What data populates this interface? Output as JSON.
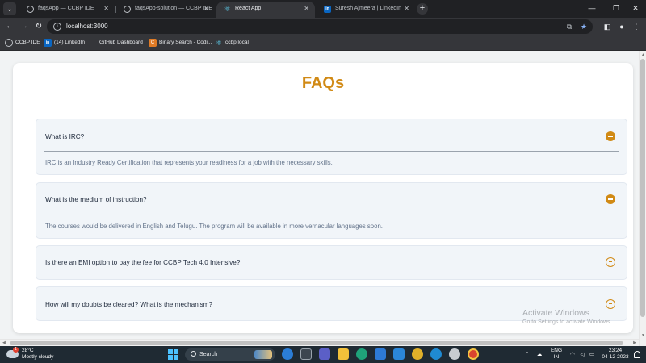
{
  "browser": {
    "tabs": [
      {
        "title": "faqsApp — CCBP IDE",
        "active": false,
        "icon": "ccbp-ide-icon"
      },
      {
        "title": "faqsApp-solution — CCBP IDE",
        "active": false,
        "icon": "ccbp-ide-icon"
      },
      {
        "title": "React App",
        "active": true,
        "icon": "react-icon"
      },
      {
        "title": "Suresh Ajmeera | LinkedIn",
        "active": false,
        "icon": "linkedin-icon"
      }
    ],
    "url": "localhost:3000",
    "bookmarks": [
      {
        "label": "CCBP IDE",
        "icon": "ccbp-ide-icon"
      },
      {
        "label": "(14) LinkedIn",
        "icon": "linkedin-icon"
      },
      {
        "label": "GitHub Dashboard",
        "icon": "github-icon"
      },
      {
        "label": "Binary Search - Codi...",
        "icon": "code-icon"
      },
      {
        "label": "ccbp local",
        "icon": "react-icon"
      }
    ]
  },
  "page": {
    "title": "FAQs",
    "accent": "#d18a15",
    "faqs": [
      {
        "question": "What is IRC?",
        "answer": "IRC is an Industry Ready Certification that represents your readiness for a job with the necessary skills.",
        "expanded": true
      },
      {
        "question": "What is the medium of instruction?",
        "answer": "The courses would be delivered in English and Telugu. The program will be available in more vernacular languages soon.",
        "expanded": true
      },
      {
        "question": "Is there an EMI option to pay the fee for CCBP Tech 4.0 Intensive?",
        "expanded": false
      },
      {
        "question": "How will my doubts be cleared? What is the mechanism?",
        "expanded": false
      }
    ]
  },
  "watermark": {
    "title": "Activate Windows",
    "subtitle": "Go to Settings to activate Windows."
  },
  "taskbar": {
    "weather": {
      "temp": "28°C",
      "condition": "Mostly cloudy",
      "badge": "1"
    },
    "search_label": "Search",
    "language": {
      "line1": "ENG",
      "line2": "IN"
    },
    "time": "23:24",
    "date": "04-12-2023"
  }
}
